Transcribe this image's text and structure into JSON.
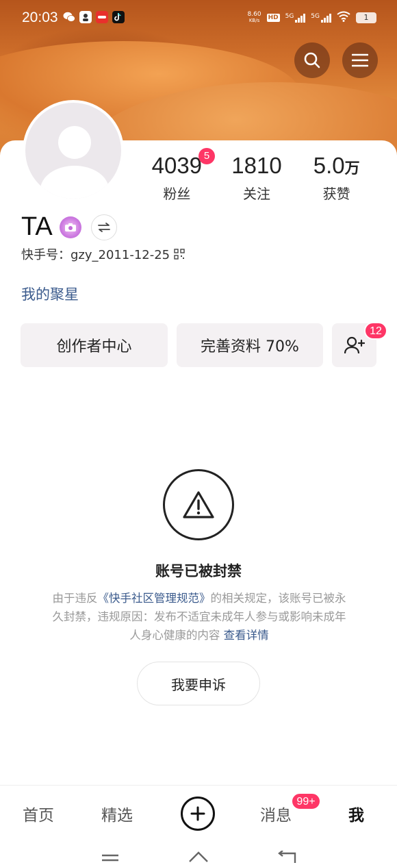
{
  "status_bar": {
    "time": "20:03",
    "net_speed_value": "8.60",
    "net_speed_unit": "KB/s",
    "hd_label": "HD",
    "sim1_label": "5G",
    "sim2_label": "5G",
    "battery": "1"
  },
  "profile": {
    "name": "TA",
    "account_id": "快手号：gzy_2011-12-25",
    "fanclub_link": "我的聚星",
    "stats": [
      {
        "value": "4039",
        "unit": "",
        "label": "粉丝",
        "badge": "5"
      },
      {
        "value": "1810",
        "unit": "",
        "label": "关注",
        "badge": ""
      },
      {
        "value": "5.0",
        "unit": "万",
        "label": "获赞",
        "badge": ""
      }
    ]
  },
  "actions": {
    "creator_center": "创作者中心",
    "complete_profile": "完善资料 70%",
    "add_friend_badge": "12"
  },
  "ban": {
    "title": "账号已被封禁",
    "desc_prefix": "由于违反",
    "desc_rule": "《快手社区管理规范》",
    "desc_main": "的相关规定，该账号已被永久封禁，违规原因：发布不适宜未成年人参与或影响未成年人身心健康的内容",
    "desc_more": "查看详情",
    "appeal_button": "我要申诉"
  },
  "tabbar": {
    "home": "首页",
    "featured": "精选",
    "messages": "消息",
    "messages_badge": "99+",
    "me": "我"
  },
  "colors": {
    "accent_badge": "#fe3666",
    "link": "#3a5a8c"
  }
}
